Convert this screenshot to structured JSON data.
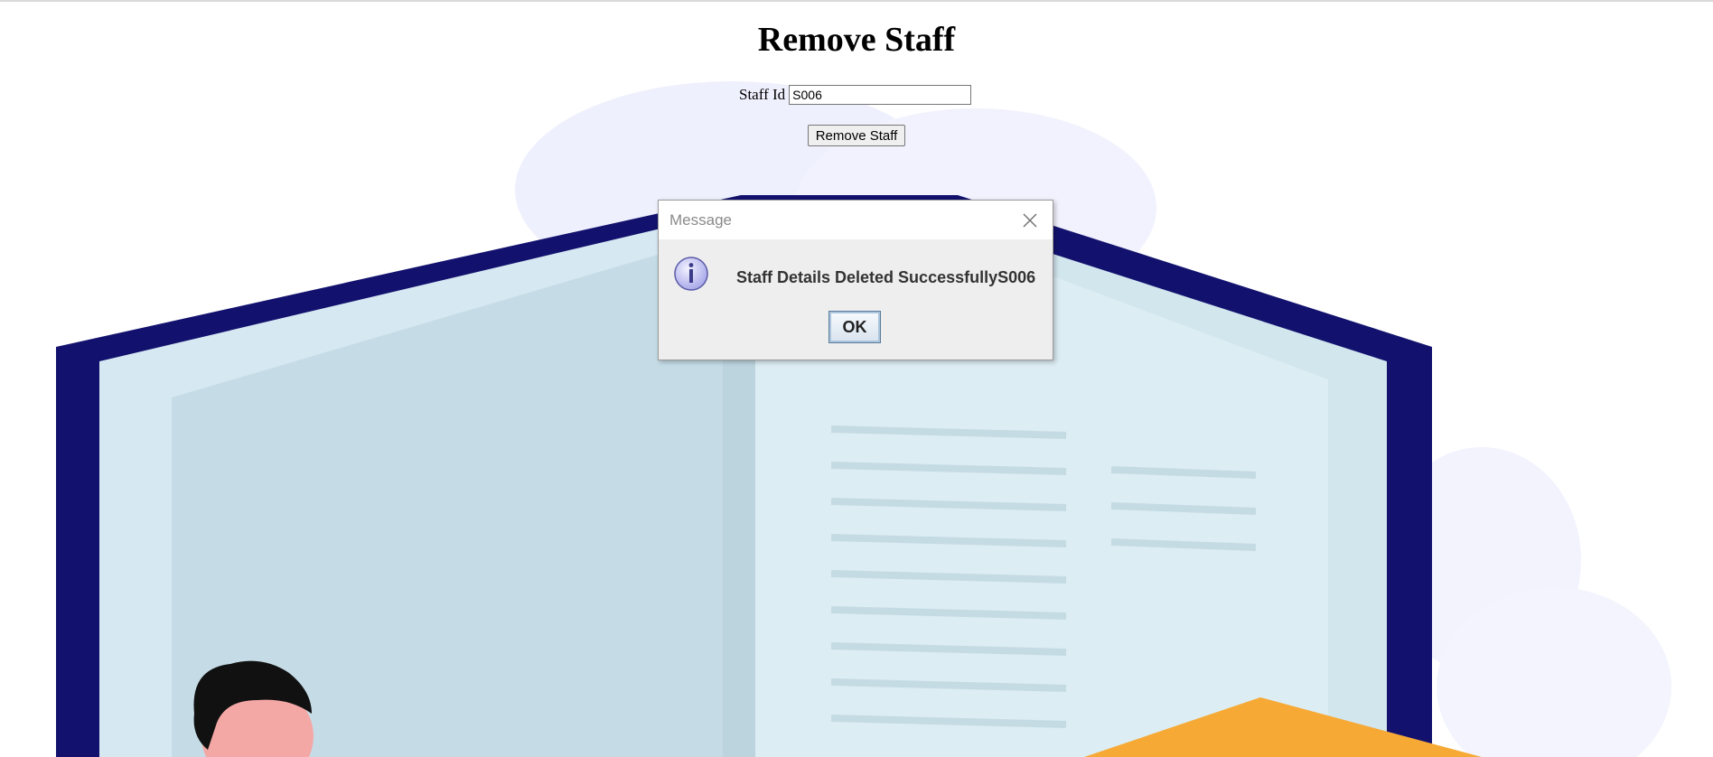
{
  "page": {
    "title": "Remove Staff"
  },
  "form": {
    "staff_id_label": "Staff Id",
    "staff_id_value": "S006",
    "submit_label": "Remove Staff"
  },
  "dialog": {
    "title": "Message",
    "message": "Staff Details Deleted SuccessfullyS006",
    "ok_label": "OK",
    "icon": "info-icon"
  },
  "colors": {
    "book_cover": "#12126e",
    "book_page": "#c9dee8",
    "cloud": "#eef0fc",
    "accent_orange": "#f7a935"
  }
}
